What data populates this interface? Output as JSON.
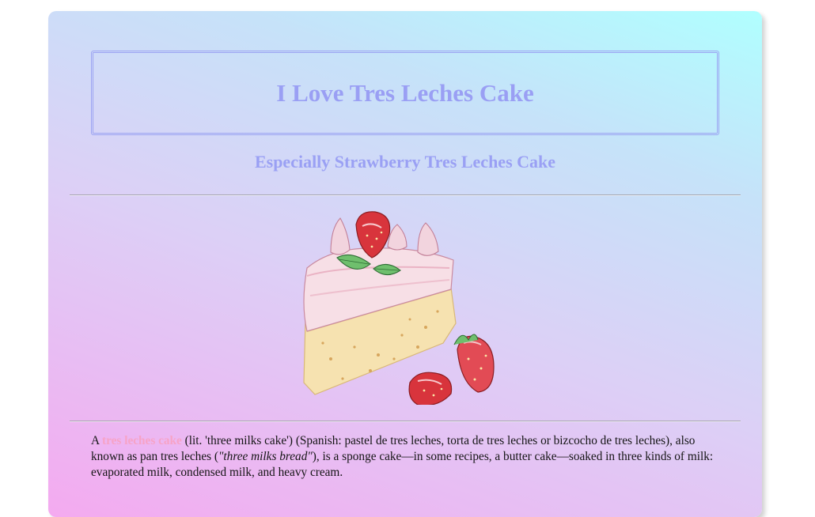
{
  "header": {
    "title": "I Love Tres Leches Cake",
    "subtitle": "Especially Strawberry Tres Leches Cake"
  },
  "illustration": {
    "icon": "strawberry-tres-leches-cake-illustration"
  },
  "description": {
    "prefix": "A",
    "term": "tres leches cake",
    "part1": "(lit. 'three milks cake') (Spanish: pastel de tres leches, torta de tres leches or bizcocho de tres leches), also known as pan tres leches (",
    "italic": "\"three milks bread\"",
    "part2": "), is a sponge cake—in some recipes, a butter cake—soaked in three kinds of milk: evaporated milk, condensed milk, and heavy cream."
  },
  "colors": {
    "title": "#9a9ff4",
    "term_link": "#f7a3c6",
    "gradient_start": "#f4aaf0",
    "gradient_end": "#b0ffff"
  }
}
